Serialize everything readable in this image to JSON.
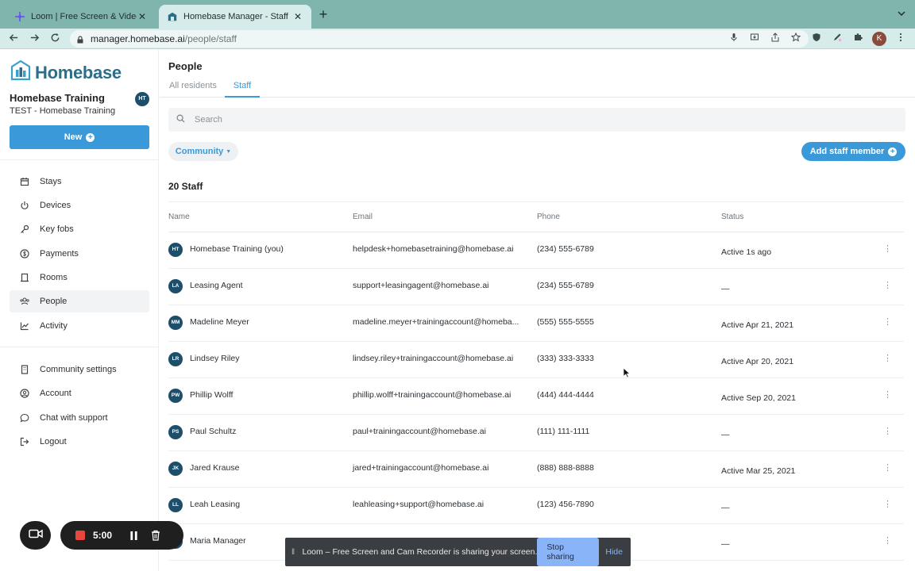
{
  "browser": {
    "tabs": [
      {
        "title": "Loom | Free Screen & Video Re",
        "active": false
      },
      {
        "title": "Homebase Manager - Staff",
        "active": true
      }
    ],
    "close_glyph": "✕",
    "new_tab_glyph": "+",
    "url_host": "manager.homebase.ai",
    "url_path": "/people/staff",
    "profile_initial": "K"
  },
  "sidebar": {
    "logo_text": "Homebase",
    "org_name": "Homebase Training",
    "org_sub": "TEST - Homebase Training",
    "org_initials": "HT",
    "new_label": "New",
    "nav": [
      {
        "label": "Stays",
        "icon": "calendar-icon"
      },
      {
        "label": "Devices",
        "icon": "power-icon"
      },
      {
        "label": "Key fobs",
        "icon": "key-icon"
      },
      {
        "label": "Payments",
        "icon": "dollar-icon"
      },
      {
        "label": "Rooms",
        "icon": "door-icon"
      },
      {
        "label": "People",
        "icon": "people-icon",
        "selected": true
      },
      {
        "label": "Activity",
        "icon": "chart-icon"
      }
    ],
    "footer_nav": [
      {
        "label": "Community settings",
        "icon": "building-icon"
      },
      {
        "label": "Account",
        "icon": "user-icon"
      },
      {
        "label": "Chat with support",
        "icon": "chat-icon"
      },
      {
        "label": "Logout",
        "icon": "logout-icon"
      }
    ]
  },
  "main": {
    "title": "People",
    "tabs": [
      {
        "label": "All residents"
      },
      {
        "label": "Staff",
        "active": true
      }
    ],
    "search_placeholder": "Search",
    "community_filter": "Community",
    "add_staff_label": "Add staff member",
    "count_label": "20 Staff",
    "columns": [
      "Name",
      "Email",
      "Phone",
      "Status"
    ],
    "rows": [
      {
        "initials": "HT",
        "name": "Homebase Training (you)",
        "email": "helpdesk+homebasetraining@homebase.ai",
        "phone": "(234) 555-6789",
        "status": "Active 1s ago"
      },
      {
        "initials": "LA",
        "name": "Leasing Agent",
        "email": "support+leasingagent@homebase.ai",
        "phone": "(234) 555-6789",
        "status": "—"
      },
      {
        "initials": "MM",
        "name": "Madeline Meyer",
        "email": "madeline.meyer+trainingaccount@homeba...",
        "phone": "(555) 555-5555",
        "status": "Active Apr 21, 2021"
      },
      {
        "initials": "LR",
        "name": "Lindsey Riley",
        "email": "lindsey.riley+trainingaccount@homebase.ai",
        "phone": "(333) 333-3333",
        "status": "Active Apr 20, 2021"
      },
      {
        "initials": "PW",
        "name": "Phillip Wolff",
        "email": "phillip.wolff+trainingaccount@homebase.ai",
        "phone": "(444) 444-4444",
        "status": "Active Sep 20, 2021"
      },
      {
        "initials": "PS",
        "name": "Paul Schultz",
        "email": "paul+trainingaccount@homebase.ai",
        "phone": "(111) 111-1111",
        "status": "—"
      },
      {
        "initials": "JK",
        "name": "Jared Krause",
        "email": "jared+trainingaccount@homebase.ai",
        "phone": "(888) 888-8888",
        "status": "Active Mar 25, 2021"
      },
      {
        "initials": "LL",
        "name": "Leah Leasing",
        "email": "leahleasing+support@homebase.ai",
        "phone": "(123) 456-7890",
        "status": "—"
      },
      {
        "initials": "",
        "name": "Maria Manager",
        "email": "",
        "phone": "",
        "status": "—"
      }
    ]
  },
  "recorder": {
    "time": "5:00"
  },
  "share_bar": {
    "message": "Loom – Free Screen and Cam Recorder is sharing your screen.",
    "stop_label": "Stop sharing",
    "hide_label": "Hide"
  },
  "colors": {
    "accent": "#3a9ad9",
    "avatar": "#1d4f6b",
    "tabbar": "#7fb5ad"
  }
}
